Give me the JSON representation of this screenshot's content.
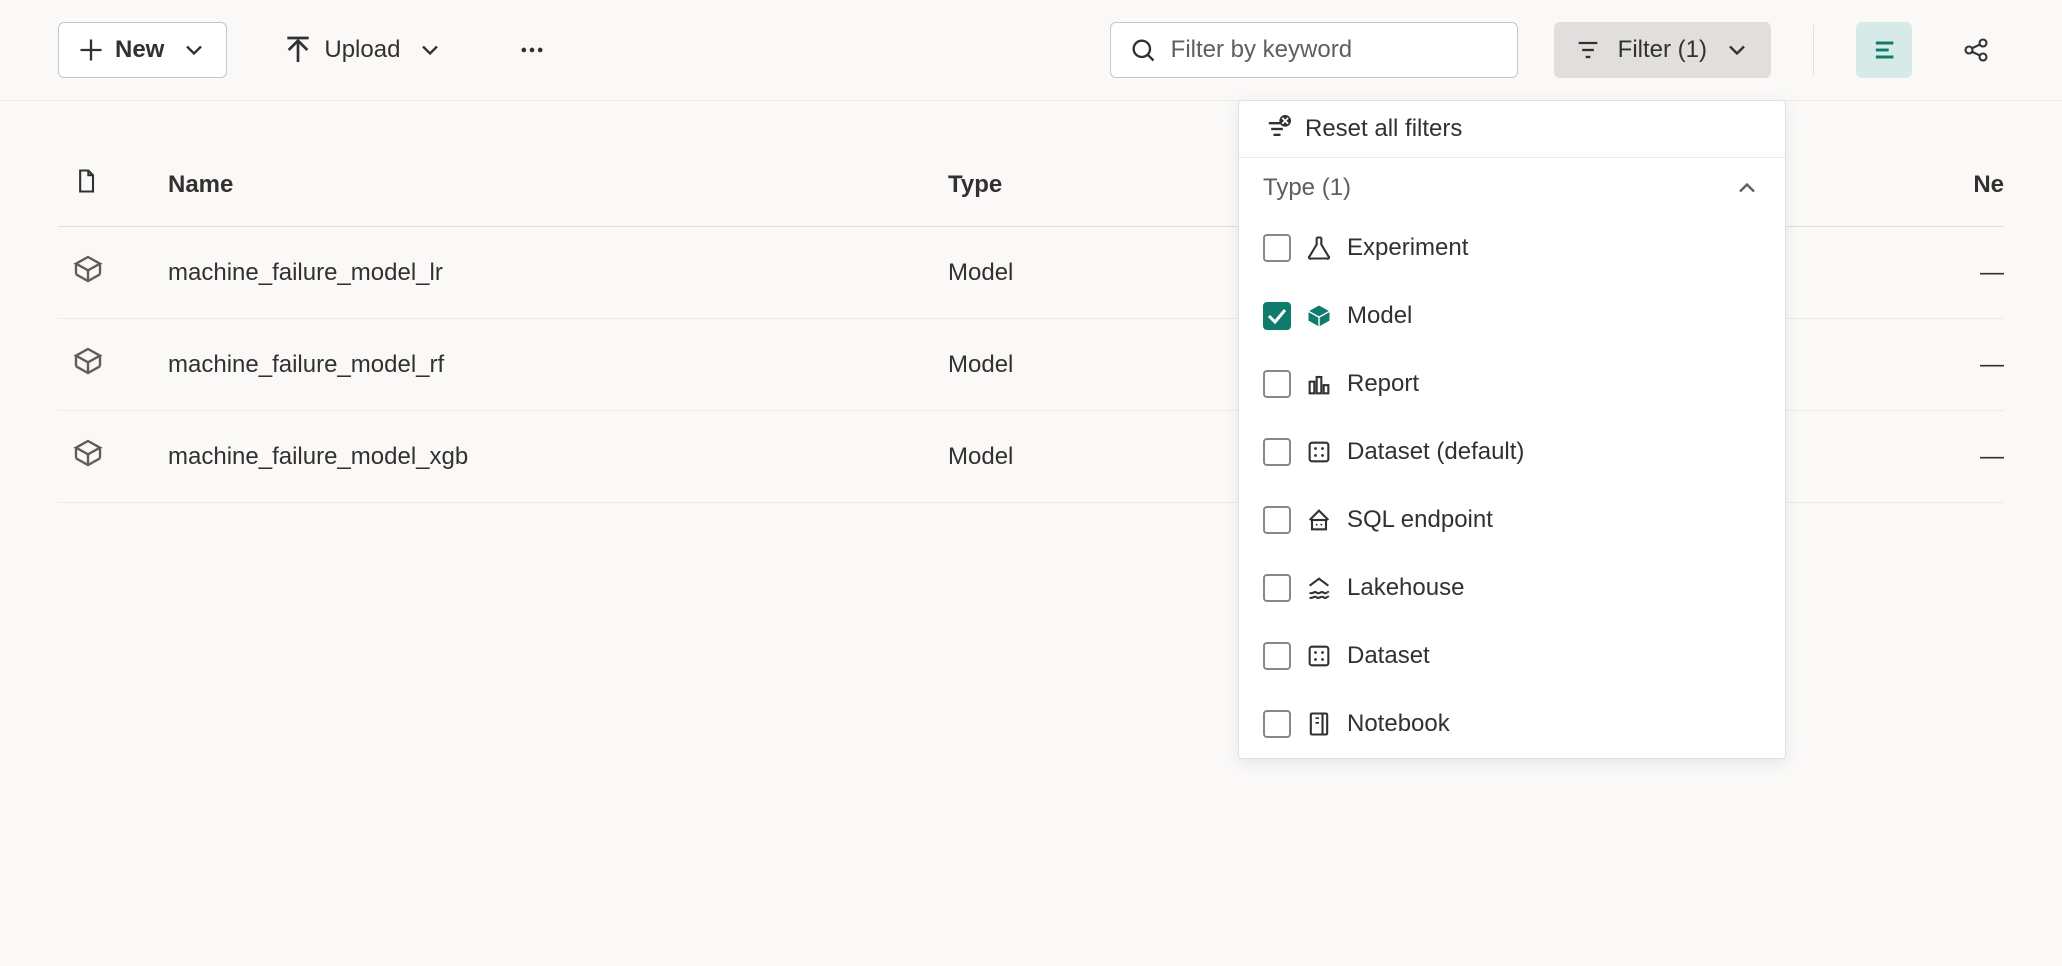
{
  "toolbar": {
    "new_label": "New",
    "upload_label": "Upload",
    "search_placeholder": "Filter by keyword",
    "filter_label": "Filter (1)"
  },
  "columns": {
    "name": "Name",
    "type": "Type",
    "next": "Ne"
  },
  "rows": [
    {
      "name": "machine_failure_model_lr",
      "type": "Model",
      "next": "—"
    },
    {
      "name": "machine_failure_model_rf",
      "type": "Model",
      "next": "—"
    },
    {
      "name": "machine_failure_model_xgb",
      "type": "Model",
      "next": "—"
    }
  ],
  "filter_panel": {
    "reset_label": "Reset all filters",
    "section_title": "Type (1)",
    "options": [
      {
        "label": "Experiment",
        "checked": false,
        "icon": "flask"
      },
      {
        "label": "Model",
        "checked": true,
        "icon": "cube"
      },
      {
        "label": "Report",
        "checked": false,
        "icon": "bars"
      },
      {
        "label": "Dataset (default)",
        "checked": false,
        "icon": "grid"
      },
      {
        "label": "SQL endpoint",
        "checked": false,
        "icon": "house"
      },
      {
        "label": "Lakehouse",
        "checked": false,
        "icon": "lake"
      },
      {
        "label": "Dataset",
        "checked": false,
        "icon": "grid"
      },
      {
        "label": "Notebook",
        "checked": false,
        "icon": "notebook"
      }
    ]
  },
  "colors": {
    "accent": "#0f7b6c"
  }
}
